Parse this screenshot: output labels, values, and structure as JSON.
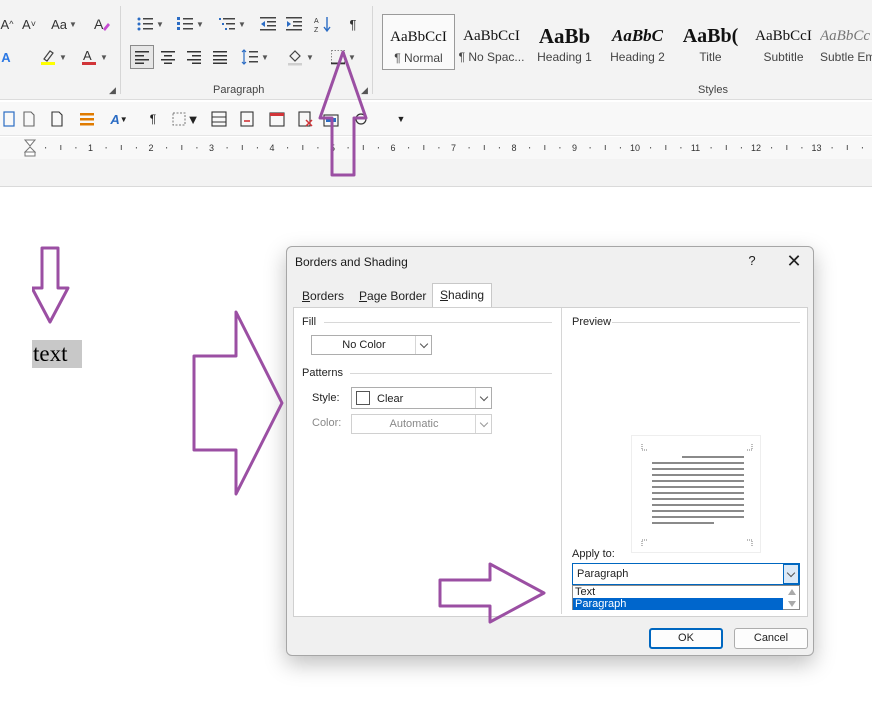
{
  "ribbon": {
    "font_size_buttons": [
      "A^",
      "A˅"
    ],
    "change_case_label": "Aa",
    "clear_formatting_label": "A",
    "font_color_label": "A",
    "highlight_label": "A",
    "paragraph_group_label": "Paragraph",
    "styles_group_label": "Styles",
    "show_marks_label": "¶",
    "sort_label": "A↓Z",
    "styles": [
      {
        "preview": "AaBbCcI",
        "name": "¶ Normal"
      },
      {
        "preview": "AaBbCcI",
        "name": "¶ No Spac..."
      },
      {
        "preview": "AaBb",
        "name": "Heading 1"
      },
      {
        "preview": "AaBbC",
        "name": "Heading 2"
      },
      {
        "preview": "AaBb(",
        "name": "Title"
      },
      {
        "preview": "AaBbCcI",
        "name": "Subtitle"
      },
      {
        "preview": "AaBbCc",
        "name": "Subtle Em"
      }
    ]
  },
  "ruler": {
    "numbers": [
      "1",
      "2",
      "3",
      "4",
      "5",
      "6",
      "7",
      "8",
      "9",
      "10",
      "11",
      "12",
      "13"
    ]
  },
  "document": {
    "text": "text"
  },
  "dialog": {
    "title": "Borders and Shading",
    "help_label": "?",
    "close_label": "✕",
    "tabs": [
      {
        "label": "Borders",
        "underline": "B",
        "rest": "orders"
      },
      {
        "label": "Page Border",
        "pre": "",
        "underline": "P",
        "rest": "age Border"
      },
      {
        "label": "Shading",
        "underline": "S",
        "rest": "hading"
      }
    ],
    "fill": {
      "label": "Fill",
      "value": "No Color"
    },
    "patterns": {
      "label": "Patterns",
      "style_label": "Style:",
      "style_value": "Clear",
      "color_label": "Color:",
      "color_value": "Automatic"
    },
    "preview_label": "Preview",
    "apply_to": {
      "label": "Apply to:",
      "value": "Paragraph",
      "options": [
        "Text",
        "Paragraph"
      ],
      "selected": "Paragraph"
    },
    "ok_label": "OK",
    "cancel_label": "Cancel"
  },
  "colors": {
    "annotation_arrow": "#9b4fa3",
    "selection": "#0066cc",
    "highlight_gray": "#c8c8c8",
    "font_color_red": "#d13438",
    "highlight_yellow": "#ffff00"
  }
}
